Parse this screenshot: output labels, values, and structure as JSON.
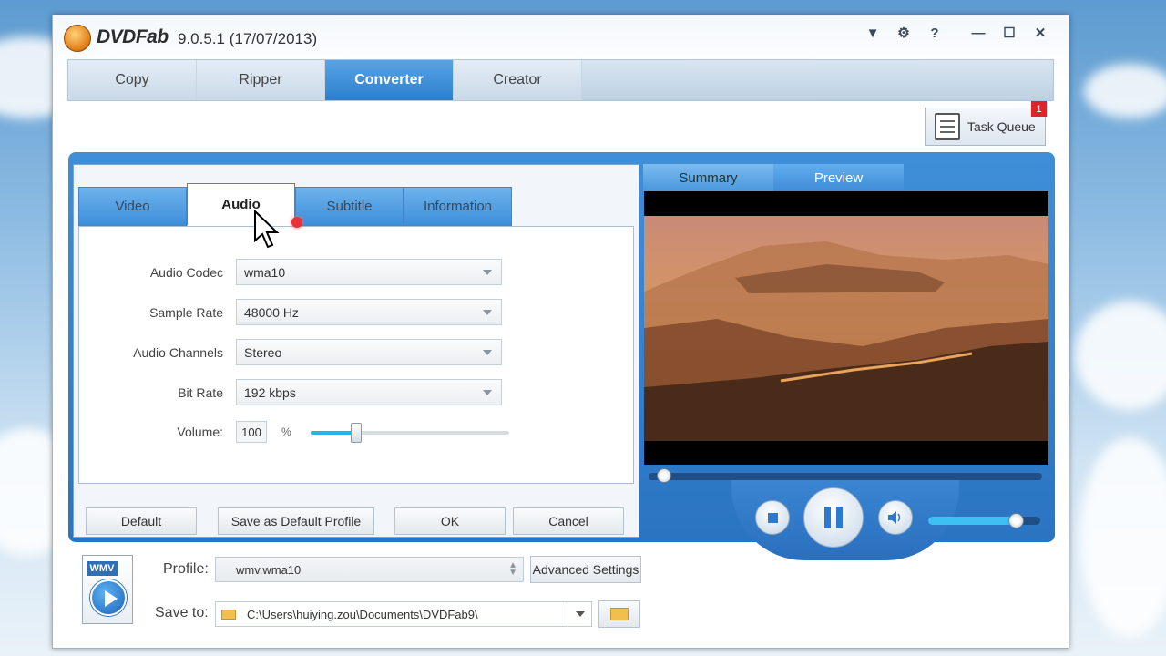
{
  "app": {
    "logo_text": "DVDFab",
    "version": "9.0.5.1 (17/07/2013)",
    "system_icons": [
      "dropdown-icon",
      "gear-icon",
      "help-icon",
      "minimize-icon",
      "maximize-icon",
      "close-icon"
    ]
  },
  "main_tabs": [
    {
      "label": "Copy",
      "active": false
    },
    {
      "label": "Ripper",
      "active": false
    },
    {
      "label": "Converter",
      "active": true
    },
    {
      "label": "Creator",
      "active": false
    }
  ],
  "task_queue": {
    "label": "Task Queue",
    "badge": "1"
  },
  "dialog": {
    "tabs": [
      {
        "label": "Video",
        "active": false
      },
      {
        "label": "Audio",
        "active": true
      },
      {
        "label": "Subtitle",
        "active": false
      },
      {
        "label": "Information",
        "active": false
      }
    ],
    "fields": {
      "audio_codec": {
        "label": "Audio Codec",
        "value": "wma10"
      },
      "sample_rate": {
        "label": "Sample Rate",
        "value": "48000 Hz"
      },
      "audio_channels": {
        "label": "Audio Channels",
        "value": "Stereo"
      },
      "bit_rate": {
        "label": "Bit Rate",
        "value": "192 kbps"
      },
      "volume": {
        "label": "Volume:",
        "value": "100",
        "unit": "%",
        "slider_fraction": 0.23
      }
    },
    "buttons": {
      "default": "Default",
      "save_default": "Save as Default Profile",
      "ok": "OK",
      "cancel": "Cancel"
    }
  },
  "preview": {
    "tabs": [
      {
        "label": "Summary",
        "active": true
      },
      {
        "label": "Preview",
        "active": false
      }
    ],
    "seek_fraction": 0.02,
    "volume_fraction": 0.78
  },
  "bottom": {
    "format_icon_label": "WMV",
    "profile_label": "Profile:",
    "profile_value": "wmv.wma10",
    "advanced_settings": "Advanced Settings",
    "save_to_label": "Save to:",
    "save_to_value": "C:\\Users\\huiying.zou\\Documents\\DVDFab9\\"
  },
  "colors": {
    "accent_blue": "#2d7fcd",
    "badge_red": "#e0232b",
    "slider_cyan": "#27b4e8"
  }
}
